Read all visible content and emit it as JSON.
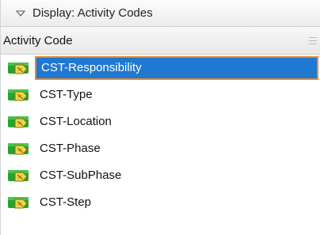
{
  "display_bar": {
    "label": "Display: Activity Codes"
  },
  "column_header": {
    "title": "Activity Code"
  },
  "rows": [
    {
      "label": "CST-Responsibility",
      "selected": true
    },
    {
      "label": "CST-Type",
      "selected": false
    },
    {
      "label": "CST-Location",
      "selected": false
    },
    {
      "label": "CST-Phase",
      "selected": false
    },
    {
      "label": "CST-SubPhase",
      "selected": false
    },
    {
      "label": "CST-Step",
      "selected": false
    }
  ],
  "icons": {
    "display_toggle": "chevron-down-icon",
    "row_icon": "activity-code-tag-icon",
    "column_menu": "column-menu-icon"
  },
  "colors": {
    "selection_background": "#1f78d1",
    "selection_border": "#e68a2e",
    "icon_green": "#27a32e",
    "icon_yellow": "#f1d54a"
  }
}
